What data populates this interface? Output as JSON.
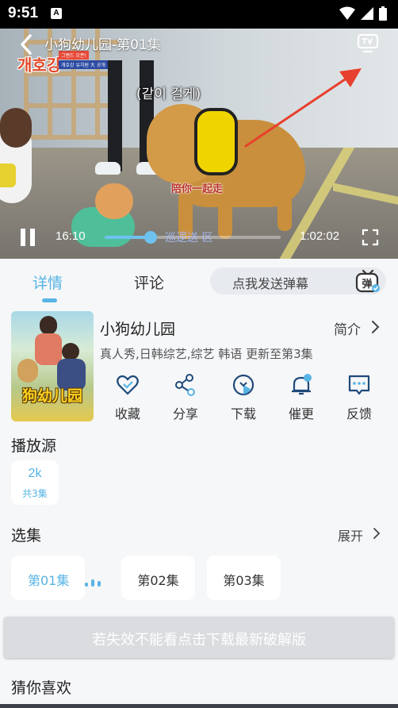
{
  "status": {
    "time": "9:51",
    "notification_badge": "A"
  },
  "player": {
    "title": "小狗幼儿园-第01集",
    "logo_text": "개호강",
    "logo_sub_top": "그랜드 오픈!",
    "logo_sub_bottom": "개호강 유치원 大 공개",
    "subtitle_korean": "(같이 걸게)",
    "subtitle_chinese": "陪你一起走",
    "current_time": "16:10",
    "total_time": "1:02:02",
    "progress_percent": 26,
    "progress_overlay_text": "巡逻送  区",
    "colors": {
      "accent": "#6ec2ef",
      "arrow": "#e8402e"
    }
  },
  "tabs": {
    "detail": "详情",
    "comments": "评论",
    "danmaku_placeholder": "点我发送弹幕",
    "danmaku_icon_text": "弹"
  },
  "show": {
    "poster_title": "狗幼儿园",
    "title": "小狗幼儿园",
    "intro_label": "简介",
    "meta": "真人秀,日韩综艺,综艺 韩语 更新至第3集"
  },
  "actions": [
    {
      "label": "收藏",
      "icon": "heart-icon"
    },
    {
      "label": "分享",
      "icon": "share-icon"
    },
    {
      "label": "下载",
      "icon": "download-icon"
    },
    {
      "label": "催更",
      "icon": "bell-icon"
    },
    {
      "label": "反馈",
      "icon": "feedback-icon"
    }
  ],
  "sources": {
    "title": "播放源",
    "items": [
      {
        "name": "2k",
        "count": "共3集"
      }
    ]
  },
  "episodes": {
    "title": "选集",
    "expand_label": "展开",
    "items": [
      {
        "label": "第01集",
        "active": true
      },
      {
        "label": "第02集",
        "active": false
      },
      {
        "label": "第03集",
        "active": false
      }
    ]
  },
  "banner": {
    "text": "若失效不能看点击下载最新破解版"
  },
  "recommend": {
    "title": "猜你喜欢"
  },
  "theme": {
    "primary": "#57b4e4",
    "background": "#f6f7f9"
  }
}
